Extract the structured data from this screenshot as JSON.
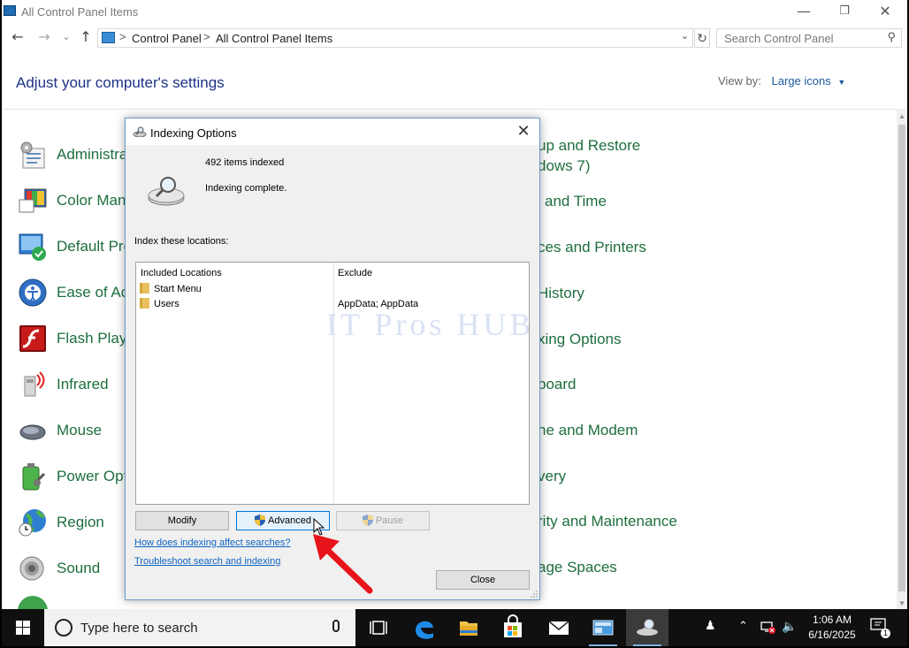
{
  "window": {
    "title": "All Control Panel Items",
    "minimize": "—",
    "restore": "❐",
    "close": "✕"
  },
  "nav": {
    "back": "←",
    "forward": "→",
    "recent": "⌄",
    "up": "↑"
  },
  "address": {
    "crumbs": [
      "Control Panel",
      "All Control Panel Items"
    ],
    "separator": ">",
    "refresh": "↻"
  },
  "search": {
    "placeholder": "Search Control Panel",
    "icon": "search-icon"
  },
  "page": {
    "heading": "Adjust your computer's settings",
    "view_by_label": "View by:",
    "view_by_value": "Large icons"
  },
  "left_items": [
    {
      "label": "Administra",
      "icon": "administrative-tools-icon"
    },
    {
      "label": "Color Mana",
      "icon": "color-management-icon"
    },
    {
      "label": "Default Pro",
      "icon": "default-programs-icon"
    },
    {
      "label": "Ease of Acc",
      "icon": "ease-of-access-icon"
    },
    {
      "label": "Flash Playe",
      "icon": "flash-player-icon"
    },
    {
      "label": "Infrared",
      "icon": "infrared-icon"
    },
    {
      "label": "Mouse",
      "icon": "mouse-icon"
    },
    {
      "label": "Power Opt",
      "icon": "power-options-icon"
    },
    {
      "label": "Region",
      "icon": "region-icon"
    },
    {
      "label": "Sound",
      "icon": "sound-icon"
    }
  ],
  "right_items": [
    "up and Restore",
    "dows 7)",
    "and Time",
    "ces and Printers",
    "History",
    "xing Options",
    "board",
    "ne and Modem",
    "very",
    "rity and Maintenance",
    "age Spaces"
  ],
  "dialog": {
    "title": "Indexing Options",
    "close": "✕",
    "items_indexed": "492 items indexed",
    "status": "Indexing complete.",
    "locations_label": "Index these locations:",
    "table": {
      "col_included": "Included Locations",
      "col_exclude": "Exclude",
      "rows": [
        {
          "location": "Start Menu",
          "exclude": ""
        },
        {
          "location": "Users",
          "exclude": "AppData; AppData"
        }
      ]
    },
    "watermark": "IT Pros HUB",
    "buttons": {
      "modify": "Modify",
      "advanced": "Advanced",
      "pause": "Pause",
      "close": "Close"
    },
    "links": {
      "how_affects": "How does indexing affect searches?",
      "troubleshoot": "Troubleshoot search and indexing"
    }
  },
  "taskbar": {
    "search_placeholder": "Type here to search",
    "time": "1:06 AM",
    "date": "6/16/2025",
    "notification_count": "1",
    "colors": {
      "background": "#101010",
      "accent": "#0078d7"
    },
    "apps": [
      "task-view-icon",
      "edge-icon",
      "file-explorer-icon",
      "store-icon",
      "mail-icon",
      "control-panel-icon",
      "indexing-options-icon"
    ]
  },
  "colors": {
    "link_green": "#1e6e3e",
    "heading_blue": "#1e3287",
    "link_blue": "#0e64c0",
    "arrow_red": "#e8141c"
  }
}
